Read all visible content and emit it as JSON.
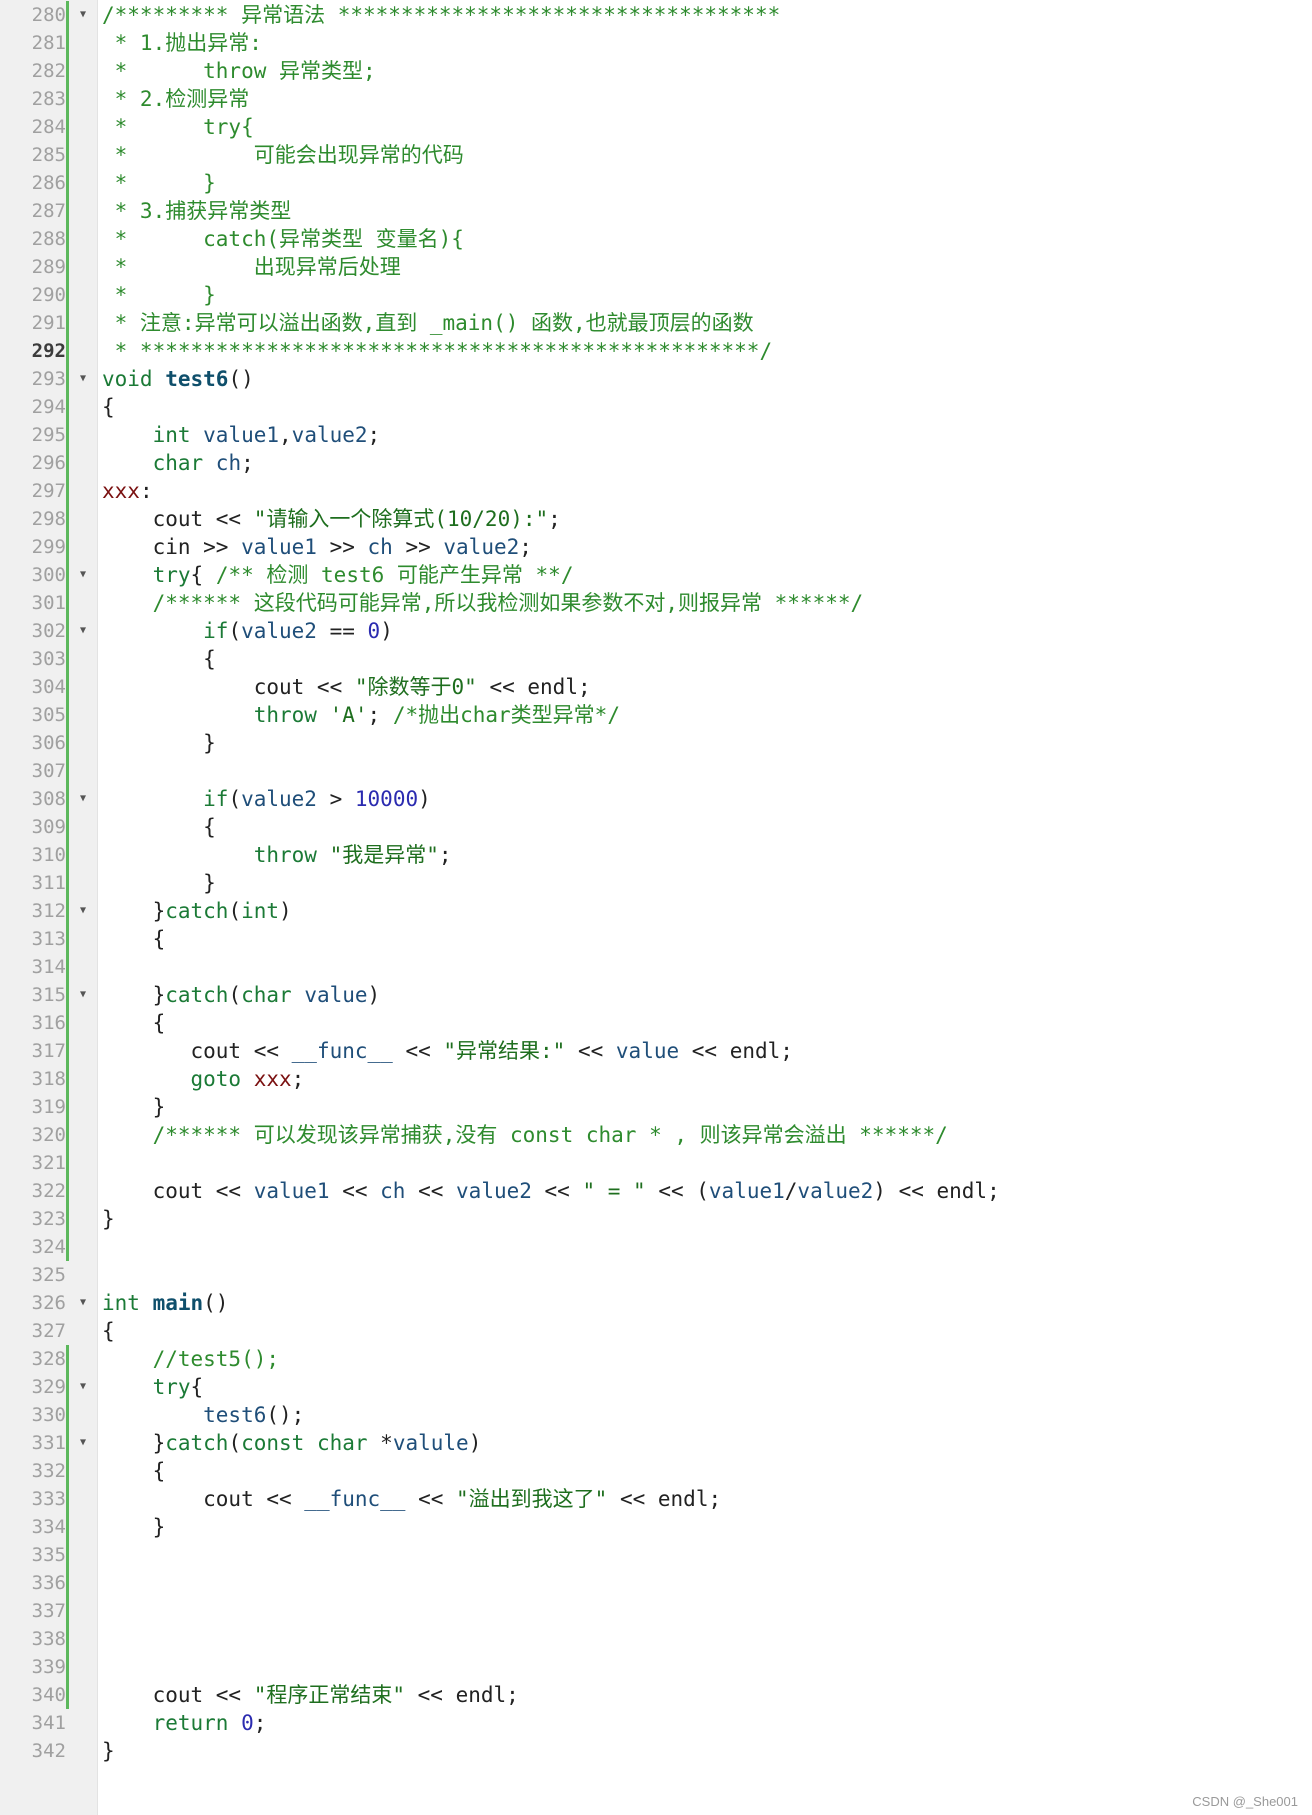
{
  "editor": {
    "current_line": 292,
    "lines": [
      {
        "n": 280,
        "fold": true,
        "change": true,
        "tokens": [
          [
            "cm",
            "/********* 异常语法 ***********************************"
          ]
        ]
      },
      {
        "n": 281,
        "change": true,
        "tokens": [
          [
            "cm",
            " * 1.抛出异常:"
          ]
        ]
      },
      {
        "n": 282,
        "change": true,
        "tokens": [
          [
            "cm",
            " *      throw 异常类型;"
          ]
        ]
      },
      {
        "n": 283,
        "change": true,
        "tokens": [
          [
            "cm",
            " * 2.检测异常"
          ]
        ]
      },
      {
        "n": 284,
        "change": true,
        "tokens": [
          [
            "cm",
            " *      try{"
          ]
        ]
      },
      {
        "n": 285,
        "change": true,
        "tokens": [
          [
            "cm",
            " *          可能会出现异常的代码"
          ]
        ]
      },
      {
        "n": 286,
        "change": true,
        "tokens": [
          [
            "cm",
            " *      }"
          ]
        ]
      },
      {
        "n": 287,
        "change": true,
        "tokens": [
          [
            "cm",
            " * 3.捕获异常类型"
          ]
        ]
      },
      {
        "n": 288,
        "change": true,
        "tokens": [
          [
            "cm",
            " *      catch(异常类型 变量名){"
          ]
        ]
      },
      {
        "n": 289,
        "change": true,
        "tokens": [
          [
            "cm",
            " *          出现异常后处理"
          ]
        ]
      },
      {
        "n": 290,
        "change": true,
        "tokens": [
          [
            "cm",
            " *      }"
          ]
        ]
      },
      {
        "n": 291,
        "change": true,
        "tokens": [
          [
            "cm",
            " * 注意:异常可以溢出函数,直到 _main() 函数,也就最顶层的函数"
          ]
        ]
      },
      {
        "n": 292,
        "change": true,
        "tokens": [
          [
            "cm",
            " * *************************************************/"
          ]
        ]
      },
      {
        "n": 293,
        "fold": true,
        "change": true,
        "tokens": [
          [
            "kw",
            "void "
          ],
          [
            "fn",
            "test6"
          ],
          [
            "op",
            "()"
          ]
        ]
      },
      {
        "n": 294,
        "change": true,
        "tokens": [
          [
            "op",
            "{"
          ]
        ]
      },
      {
        "n": 295,
        "change": true,
        "tokens": [
          [
            "kw",
            "    int "
          ],
          [
            "id",
            "value1"
          ],
          [
            "op",
            ","
          ],
          [
            "id",
            "value2"
          ],
          [
            "op",
            ";"
          ]
        ]
      },
      {
        "n": 296,
        "change": true,
        "tokens": [
          [
            "kw",
            "    char "
          ],
          [
            "id",
            "ch"
          ],
          [
            "op",
            ";"
          ]
        ]
      },
      {
        "n": 297,
        "change": true,
        "tokens": [
          [
            "lbl",
            "xxx"
          ],
          [
            "op",
            ":"
          ]
        ]
      },
      {
        "n": 298,
        "change": true,
        "tokens": [
          [
            "op",
            "    cout << "
          ],
          [
            "str",
            "\"请输入一个除算式(10/20):\""
          ],
          [
            "op",
            ";"
          ]
        ]
      },
      {
        "n": 299,
        "change": true,
        "tokens": [
          [
            "op",
            "    cin >> "
          ],
          [
            "id",
            "value1"
          ],
          [
            "op",
            " >> "
          ],
          [
            "id",
            "ch"
          ],
          [
            "op",
            " >> "
          ],
          [
            "id",
            "value2"
          ],
          [
            "op",
            ";"
          ]
        ]
      },
      {
        "n": 300,
        "fold": true,
        "change": true,
        "tokens": [
          [
            "kw",
            "    try"
          ],
          [
            "op",
            "{ "
          ],
          [
            "cm",
            "/** 检测 test6 可能产生异常 **/"
          ]
        ]
      },
      {
        "n": 301,
        "change": true,
        "tokens": [
          [
            "cm",
            "    /****** 这段代码可能异常,所以我检测如果参数不对,则报异常 ******/"
          ]
        ]
      },
      {
        "n": 302,
        "fold": true,
        "change": true,
        "tokens": [
          [
            "kw",
            "        if"
          ],
          [
            "op",
            "("
          ],
          [
            "id",
            "value2"
          ],
          [
            "op",
            " == "
          ],
          [
            "num",
            "0"
          ],
          [
            "op",
            ")"
          ]
        ]
      },
      {
        "n": 303,
        "change": true,
        "tokens": [
          [
            "op",
            "        {"
          ]
        ]
      },
      {
        "n": 304,
        "change": true,
        "tokens": [
          [
            "op",
            "            cout << "
          ],
          [
            "str",
            "\"除数等于0\""
          ],
          [
            "op",
            " << endl;"
          ]
        ]
      },
      {
        "n": 305,
        "change": true,
        "tokens": [
          [
            "kw",
            "            throw "
          ],
          [
            "str",
            "'A'"
          ],
          [
            "op",
            "; "
          ],
          [
            "cm",
            "/*抛出char类型异常*/"
          ]
        ]
      },
      {
        "n": 306,
        "change": true,
        "tokens": [
          [
            "op",
            "        }"
          ]
        ]
      },
      {
        "n": 307,
        "change": true,
        "tokens": []
      },
      {
        "n": 308,
        "fold": true,
        "change": true,
        "tokens": [
          [
            "kw",
            "        if"
          ],
          [
            "op",
            "("
          ],
          [
            "id",
            "value2"
          ],
          [
            "op",
            " > "
          ],
          [
            "num",
            "10000"
          ],
          [
            "op",
            ")"
          ]
        ]
      },
      {
        "n": 309,
        "change": true,
        "tokens": [
          [
            "op",
            "        {"
          ]
        ]
      },
      {
        "n": 310,
        "change": true,
        "tokens": [
          [
            "kw",
            "            throw "
          ],
          [
            "str",
            "\"我是异常\""
          ],
          [
            "op",
            ";"
          ]
        ]
      },
      {
        "n": 311,
        "change": true,
        "tokens": [
          [
            "op",
            "        }"
          ]
        ]
      },
      {
        "n": 312,
        "fold": true,
        "change": true,
        "tokens": [
          [
            "op",
            "    }"
          ],
          [
            "kw",
            "catch"
          ],
          [
            "op",
            "("
          ],
          [
            "kw",
            "int"
          ],
          [
            "op",
            ")"
          ]
        ]
      },
      {
        "n": 313,
        "change": true,
        "tokens": [
          [
            "op",
            "    {"
          ]
        ]
      },
      {
        "n": 314,
        "change": true,
        "tokens": []
      },
      {
        "n": 315,
        "fold": true,
        "change": true,
        "tokens": [
          [
            "op",
            "    }"
          ],
          [
            "kw",
            "catch"
          ],
          [
            "op",
            "("
          ],
          [
            "kw",
            "char "
          ],
          [
            "id",
            "value"
          ],
          [
            "op",
            ")"
          ]
        ]
      },
      {
        "n": 316,
        "change": true,
        "tokens": [
          [
            "op",
            "    {"
          ]
        ]
      },
      {
        "n": 317,
        "change": true,
        "tokens": [
          [
            "op",
            "       cout << "
          ],
          [
            "id",
            "__func__"
          ],
          [
            "op",
            " << "
          ],
          [
            "str",
            "\"异常结果:\""
          ],
          [
            "op",
            " << "
          ],
          [
            "id",
            "value"
          ],
          [
            "op",
            " << endl;"
          ]
        ]
      },
      {
        "n": 318,
        "change": true,
        "tokens": [
          [
            "kw",
            "       goto "
          ],
          [
            "lbl",
            "xxx"
          ],
          [
            "op",
            ";"
          ]
        ]
      },
      {
        "n": 319,
        "change": true,
        "tokens": [
          [
            "op",
            "    }"
          ]
        ]
      },
      {
        "n": 320,
        "change": true,
        "tokens": [
          [
            "cm",
            "    /****** 可以发现该异常捕获,没有 const char * , 则该异常会溢出 ******/"
          ]
        ]
      },
      {
        "n": 321,
        "change": true,
        "tokens": []
      },
      {
        "n": 322,
        "change": true,
        "tokens": [
          [
            "op",
            "    cout << "
          ],
          [
            "id",
            "value1"
          ],
          [
            "op",
            " << "
          ],
          [
            "id",
            "ch"
          ],
          [
            "op",
            " << "
          ],
          [
            "id",
            "value2"
          ],
          [
            "op",
            " << "
          ],
          [
            "str",
            "\" = \""
          ],
          [
            "op",
            " << ("
          ],
          [
            "id",
            "value1"
          ],
          [
            "op",
            "/"
          ],
          [
            "id",
            "value2"
          ],
          [
            "op",
            ") << endl;"
          ]
        ]
      },
      {
        "n": 323,
        "change": true,
        "tokens": [
          [
            "op",
            "}"
          ]
        ]
      },
      {
        "n": 324,
        "change": true,
        "tokens": []
      },
      {
        "n": 325,
        "tokens": []
      },
      {
        "n": 326,
        "fold": true,
        "tokens": [
          [
            "kw",
            "int "
          ],
          [
            "fn",
            "main"
          ],
          [
            "op",
            "()"
          ]
        ]
      },
      {
        "n": 327,
        "tokens": [
          [
            "op",
            "{"
          ]
        ]
      },
      {
        "n": 328,
        "change": true,
        "tokens": [
          [
            "cm",
            "    //test5();"
          ]
        ]
      },
      {
        "n": 329,
        "fold": true,
        "change": true,
        "tokens": [
          [
            "kw",
            "    try"
          ],
          [
            "op",
            "{"
          ]
        ]
      },
      {
        "n": 330,
        "change": true,
        "tokens": [
          [
            "id",
            "        test6"
          ],
          [
            "op",
            "();"
          ]
        ]
      },
      {
        "n": 331,
        "fold": true,
        "change": true,
        "tokens": [
          [
            "op",
            "    }"
          ],
          [
            "kw",
            "catch"
          ],
          [
            "op",
            "("
          ],
          [
            "kw",
            "const char "
          ],
          [
            "op",
            "*"
          ],
          [
            "id",
            "valule"
          ],
          [
            "op",
            ")"
          ]
        ]
      },
      {
        "n": 332,
        "change": true,
        "tokens": [
          [
            "op",
            "    {"
          ]
        ]
      },
      {
        "n": 333,
        "change": true,
        "tokens": [
          [
            "op",
            "        cout << "
          ],
          [
            "id",
            "__func__"
          ],
          [
            "op",
            " << "
          ],
          [
            "str",
            "\"溢出到我这了\""
          ],
          [
            "op",
            " << endl;"
          ]
        ]
      },
      {
        "n": 334,
        "change": true,
        "tokens": [
          [
            "op",
            "    }"
          ]
        ]
      },
      {
        "n": 335,
        "change": true,
        "tokens": []
      },
      {
        "n": 336,
        "change": true,
        "tokens": []
      },
      {
        "n": 337,
        "change": true,
        "tokens": []
      },
      {
        "n": 338,
        "change": true,
        "tokens": []
      },
      {
        "n": 339,
        "change": true,
        "tokens": []
      },
      {
        "n": 340,
        "change": true,
        "tokens": [
          [
            "op",
            "    cout << "
          ],
          [
            "str",
            "\"程序正常结束\""
          ],
          [
            "op",
            " << endl;"
          ]
        ]
      },
      {
        "n": 341,
        "tokens": [
          [
            "kw",
            "    return "
          ],
          [
            "num",
            "0"
          ],
          [
            "op",
            ";"
          ]
        ]
      },
      {
        "n": 342,
        "tokens": [
          [
            "op",
            "}"
          ]
        ]
      }
    ]
  },
  "watermark": "CSDN @_She001"
}
